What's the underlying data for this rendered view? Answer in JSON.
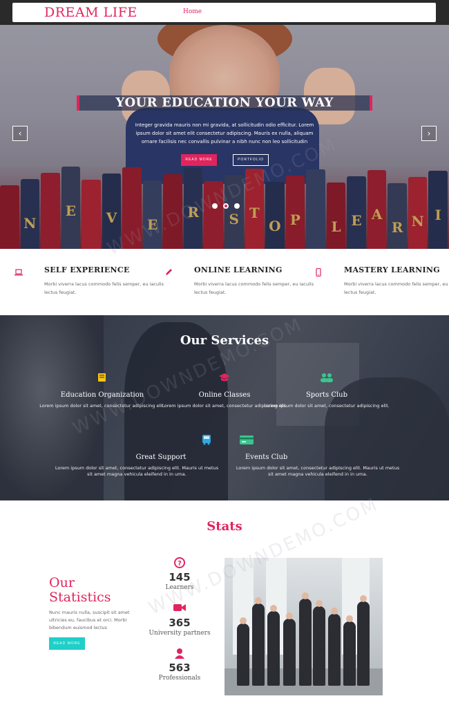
{
  "nav": {
    "brand": "DREAM LIFE",
    "home": "Home"
  },
  "hero": {
    "title": "YOUR EDUCATION YOUR WAY",
    "text": "Integer gravida mauris non mi gravida, at sollicitudin odio efficitur. Lorem ipsum dolor sit amet elit consectetur adipiscing. Mauris ex nulla, aliquam ornare facilisis nec convallis pulvinar a nibh nunc non leo sollicitudin",
    "read_more": "READ MORE",
    "portfolio": "PORTFOLIO",
    "prev_arrow": "‹",
    "next_arrow": "›",
    "book_letters": [
      "N",
      "E",
      "V",
      "E",
      "R",
      "S",
      "T",
      "O",
      "P",
      "L",
      "E",
      "A",
      "R",
      "N",
      "I"
    ],
    "slide_count": 3,
    "active_slide": 2
  },
  "features": [
    {
      "icon": "laptop-icon",
      "title": "SELF EXPERIENCE",
      "text": "Morbi viverra lacus commodo felis semper, eu iaculis lectus feugiat."
    },
    {
      "icon": "pencil-icon",
      "title": "ONLINE LEARNING",
      "text": "Morbi viverra lacus commodo felis semper, eu iaculis lectus feugiat."
    },
    {
      "icon": "mobile-icon",
      "title": "MASTERY LEARNING",
      "text": "Morbi viverra lacus commodo felis semper, eu iaculis lectus feugiat."
    }
  ],
  "services": {
    "title": "Our Services",
    "items": [
      {
        "icon": "book-icon",
        "title": "Education Organization",
        "text": "Lorem ipsum dolor sit amet, consectetur adipiscing elit."
      },
      {
        "icon": "graduation-cap-icon",
        "title": "Online Classes",
        "text": "Lorem ipsum dolor sit amet, consectetur adipiscing elit."
      },
      {
        "icon": "users-icon",
        "title": "Sports Club",
        "text": "Lorem ipsum dolor sit amet, consectetur adipiscing elit."
      },
      {
        "icon": "bus-icon",
        "title": "Great Support",
        "text": "Lorem ipsum dolor sit amet, consectetur adipiscing elit. Mauris ut metus sit amet magna vehicula eleifend in in urna."
      },
      {
        "icon": "credit-card-icon",
        "title": "Events Club",
        "text": "Lorem ipsum dolor sit amet, consectetur adipiscing elit. Mauris ut metus sit amet magna vehicula eleifend in in urna."
      }
    ]
  },
  "stats": {
    "title": "Stats",
    "heading_line1": "Our",
    "heading_line2": "Statistics",
    "description": "Nunc mauris nulla, suscipit sit amet ultricies eu, faucibus et orci. Morbi bibendum euismod lectus",
    "read_more": "READ MORE",
    "items": [
      {
        "icon": "question-circle-icon",
        "value": "145",
        "label": "Learners"
      },
      {
        "icon": "video-camera-icon",
        "value": "365",
        "label": "University partners"
      },
      {
        "icon": "user-icon",
        "value": "563",
        "label": "Professionals"
      }
    ]
  },
  "watermark": "WWW.DOWNDEMO.COM",
  "colors": {
    "accent": "#e0245e",
    "teal": "#1fcfc8",
    "service_icon_yellow": "#f5c518",
    "service_icon_pink": "#e0245e",
    "service_icon_green": "#3cc48f",
    "service_icon_blue": "#2fa8e0",
    "dark_nav": "#2a2a2a"
  }
}
